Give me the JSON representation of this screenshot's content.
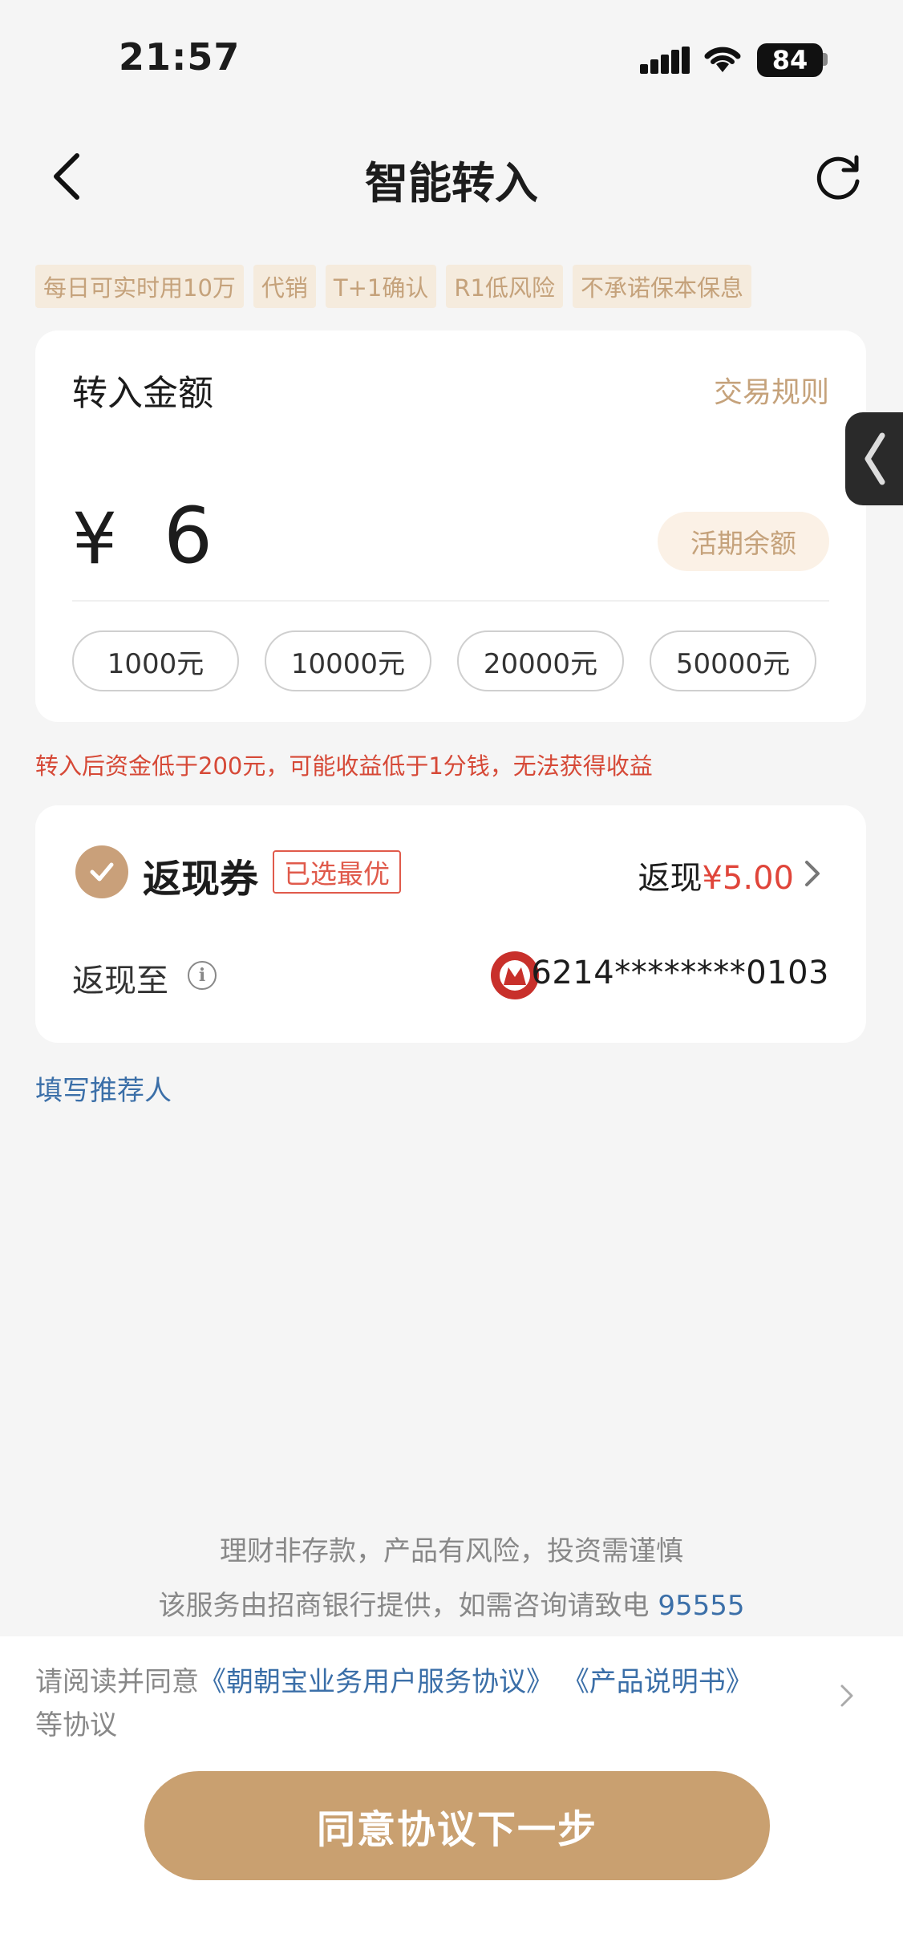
{
  "status_bar": {
    "time": "21:57",
    "battery": "84"
  },
  "header": {
    "title": "智能转入"
  },
  "tags": [
    "每日可实时用10万",
    "代销",
    "T+1确认",
    "R1低风险",
    "不承诺保本保息"
  ],
  "amount_card": {
    "label": "转入金额",
    "rules_link": "交易规则",
    "currency": "¥",
    "value": "6",
    "balance_button": "活期余额",
    "presets": [
      "1000元",
      "10000元",
      "20000元",
      "50000元"
    ]
  },
  "warning": "转入后资金低于200元，可能收益低于1分钱，无法获得收益",
  "cashback_card": {
    "title": "返现券",
    "badge": "已选最优",
    "cashback_prefix": "返现",
    "cashback_amount": "¥5.00",
    "cash_to_label": "返现至",
    "card_number": "6214********0103"
  },
  "referrer_link": "填写推荐人",
  "disclaimer": {
    "line1": "理财非存款，产品有风险，投资需谨慎",
    "line2": "该服务由招商银行提供，如需咨询请致电",
    "phone": "95555"
  },
  "agreement": {
    "prefix": "请阅读并同意",
    "doc1": "《朝朝宝业务用户服务协议》",
    "doc2": "《产品说明书》",
    "suffix": "等协议"
  },
  "submit_button": "同意协议下一步",
  "colors": {
    "accent": "#c9a070",
    "warning": "#d64937",
    "link": "#3b6fa8"
  }
}
